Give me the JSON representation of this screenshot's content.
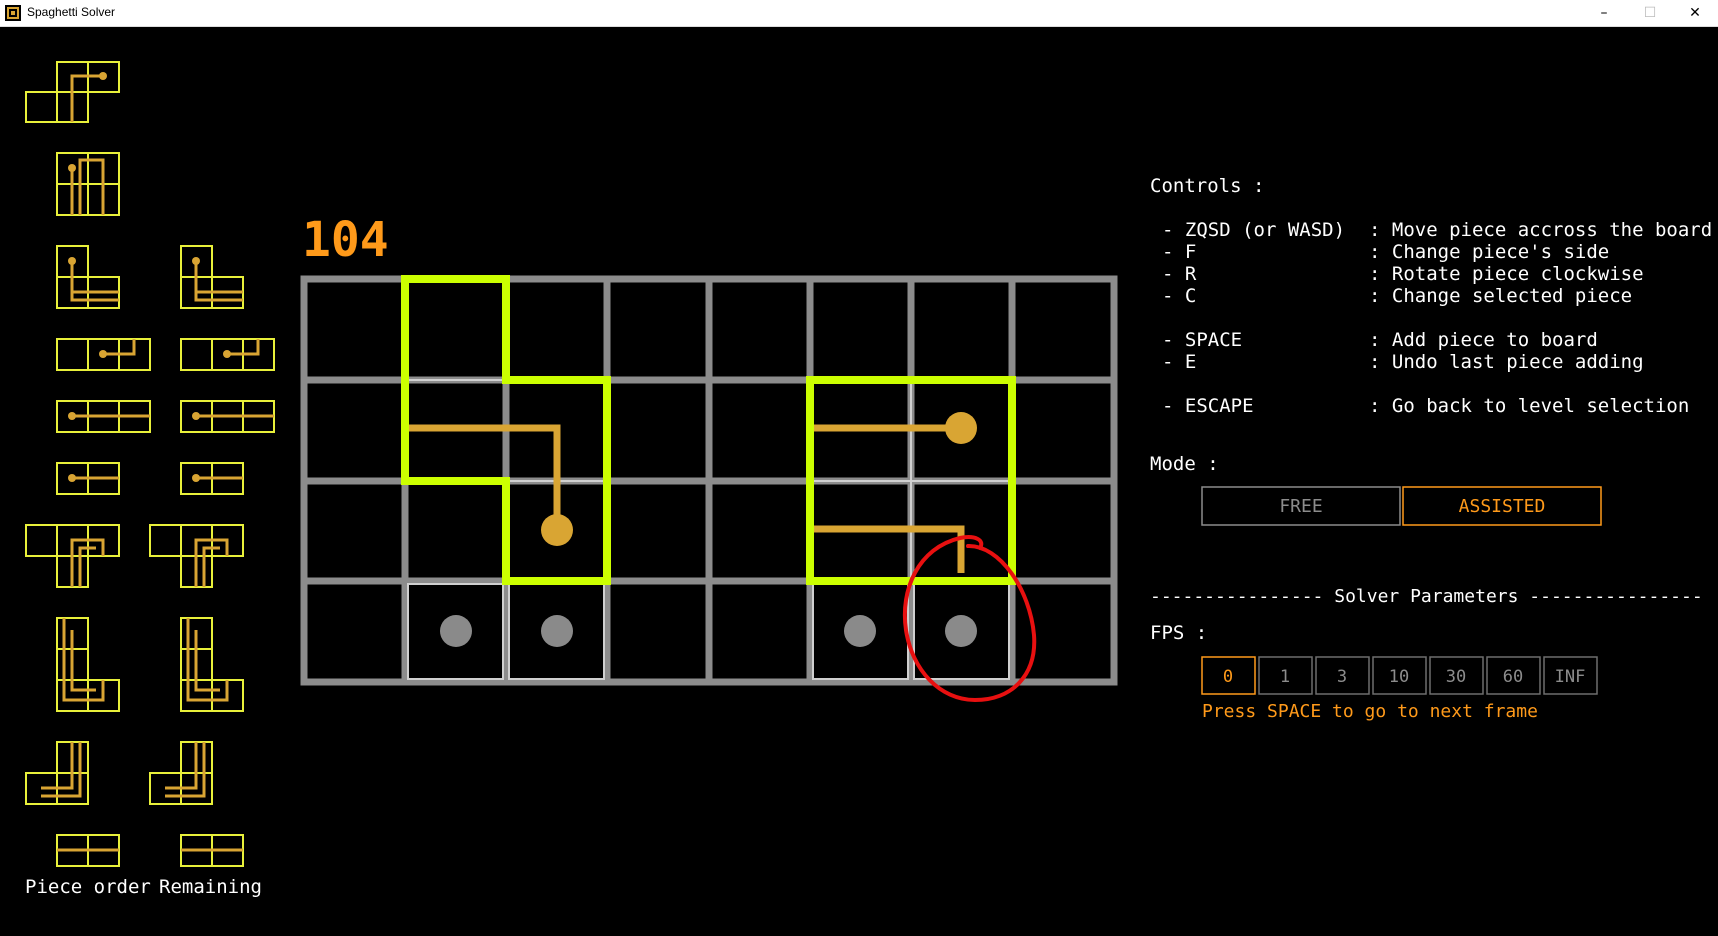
{
  "window": {
    "title": "Spaghetti Solver",
    "controls": {
      "minimize": "–",
      "maximize": "☐",
      "close": "✕"
    }
  },
  "colors": {
    "background": "#000000",
    "board_grid": "#8c8c8c",
    "piece_outline": "#ccff00",
    "noodle": "#d9a533",
    "accent_orange": "#ff9a1a",
    "palette_outline": "#e8f03a",
    "hole": "#8a8a8a",
    "annotation_red": "#e81010",
    "text": "#ffffff"
  },
  "score": "104",
  "board": {
    "cols": 8,
    "rows": 4
  },
  "panel": {
    "controls_title": "Controls :",
    "controls": [
      {
        "key": "- ZQSD (or WASD)",
        "desc": ": Move piece accross the board"
      },
      {
        "key": "- F",
        "desc": ": Change piece's side"
      },
      {
        "key": "- R",
        "desc": ": Rotate piece clockwise"
      },
      {
        "key": "- C",
        "desc": ": Change selected piece"
      },
      {
        "key": "- SPACE",
        "desc": ": Add piece to board"
      },
      {
        "key": "- E",
        "desc": ": Undo last piece adding"
      },
      {
        "key": "- ESCAPE",
        "desc": ": Go back to level selection"
      }
    ],
    "mode_title": "Mode :",
    "modes": [
      {
        "label": "FREE",
        "selected": false
      },
      {
        "label": "ASSISTED",
        "selected": true
      }
    ],
    "solver_title": "---------------- Solver Parameters ----------------",
    "fps_title": "FPS :",
    "fps_options": [
      {
        "label": "0",
        "selected": true
      },
      {
        "label": "1",
        "selected": false
      },
      {
        "label": "3",
        "selected": false
      },
      {
        "label": "10",
        "selected": false
      },
      {
        "label": "30",
        "selected": false
      },
      {
        "label": "60",
        "selected": false
      },
      {
        "label": "INF",
        "selected": false
      }
    ],
    "hint": "Press SPACE to go to next frame"
  },
  "sidebar": {
    "piece_order_label": "Piece order",
    "remaining_label": "Remaining"
  }
}
